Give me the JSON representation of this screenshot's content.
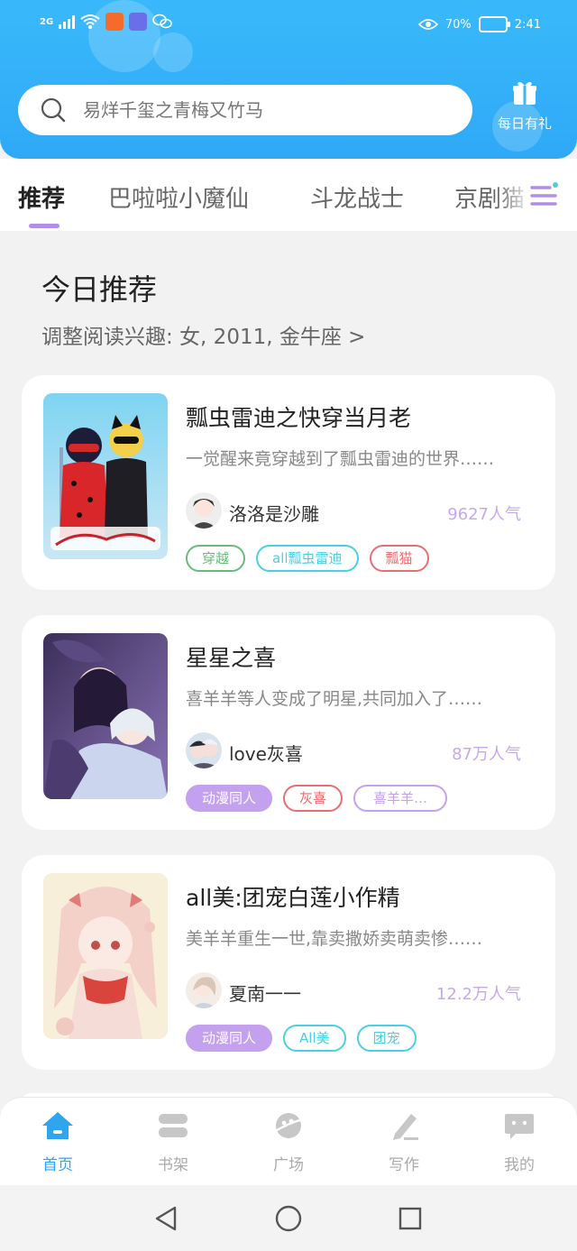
{
  "status_bar": {
    "network": "2G",
    "battery": "70%",
    "time": "2:41"
  },
  "search": {
    "placeholder": "易烊千玺之青梅又竹马"
  },
  "gift": {
    "label": "每日有礼"
  },
  "tabs": [
    {
      "label": "推荐",
      "active": true
    },
    {
      "label": "巴啦啦小魔仙",
      "active": false
    },
    {
      "label": "斗龙战士",
      "active": false
    },
    {
      "label": "京剧猫",
      "active": false
    }
  ],
  "section": {
    "title": "今日推荐",
    "subtitle": "调整阅读兴趣: 女, 2011, 金牛座 >"
  },
  "books": [
    {
      "title": "瓢虫雷迪之快穿当月老",
      "desc": "一觉醒来竟穿越到了瓢虫雷迪的世界……",
      "author": "洛洛是沙雕",
      "popularity": "9627人气",
      "tags": [
        {
          "label": "穿越",
          "color": "#68bb7a"
        },
        {
          "label": "all瓢虫雷迪",
          "color": "#4ccfe0"
        },
        {
          "label": "瓢猫",
          "color": "#ea6d73"
        }
      ]
    },
    {
      "title": "星星之喜",
      "desc": "喜羊羊等人变成了明星,共同加入了……",
      "author": "love灰喜",
      "popularity": "87万人气",
      "tags": [
        {
          "label": "动漫同人",
          "color": "#c4a1ee",
          "filled": true
        },
        {
          "label": "灰喜",
          "color": "#ea6d73"
        },
        {
          "label": "喜羊羊…",
          "color": "#c4a1ee"
        }
      ]
    },
    {
      "title": "all美:团宠白莲小作精",
      "desc": "美羊羊重生一世,靠卖撒娇卖萌卖惨……",
      "author": "夏南一一",
      "popularity": "12.2万人气",
      "tags": [
        {
          "label": "动漫同人",
          "color": "#c4a1ee",
          "filled": true
        },
        {
          "label": "All美",
          "color": "#4ccfe0"
        },
        {
          "label": "团宠",
          "color": "#4ccfe0"
        }
      ]
    }
  ],
  "bottom_nav": [
    {
      "label": "首页",
      "icon": "home-icon",
      "active": true
    },
    {
      "label": "书架",
      "icon": "bookshelf-icon",
      "active": false
    },
    {
      "label": "广场",
      "icon": "planet-icon",
      "active": false
    },
    {
      "label": "写作",
      "icon": "pen-icon",
      "active": false
    },
    {
      "label": "我的",
      "icon": "chat-face-icon",
      "active": false
    }
  ],
  "colors": {
    "header": "#2fa9f6",
    "accent": "#b18ee8",
    "popularity": "#c5a8ee",
    "nav_active": "#2fa5ee"
  }
}
